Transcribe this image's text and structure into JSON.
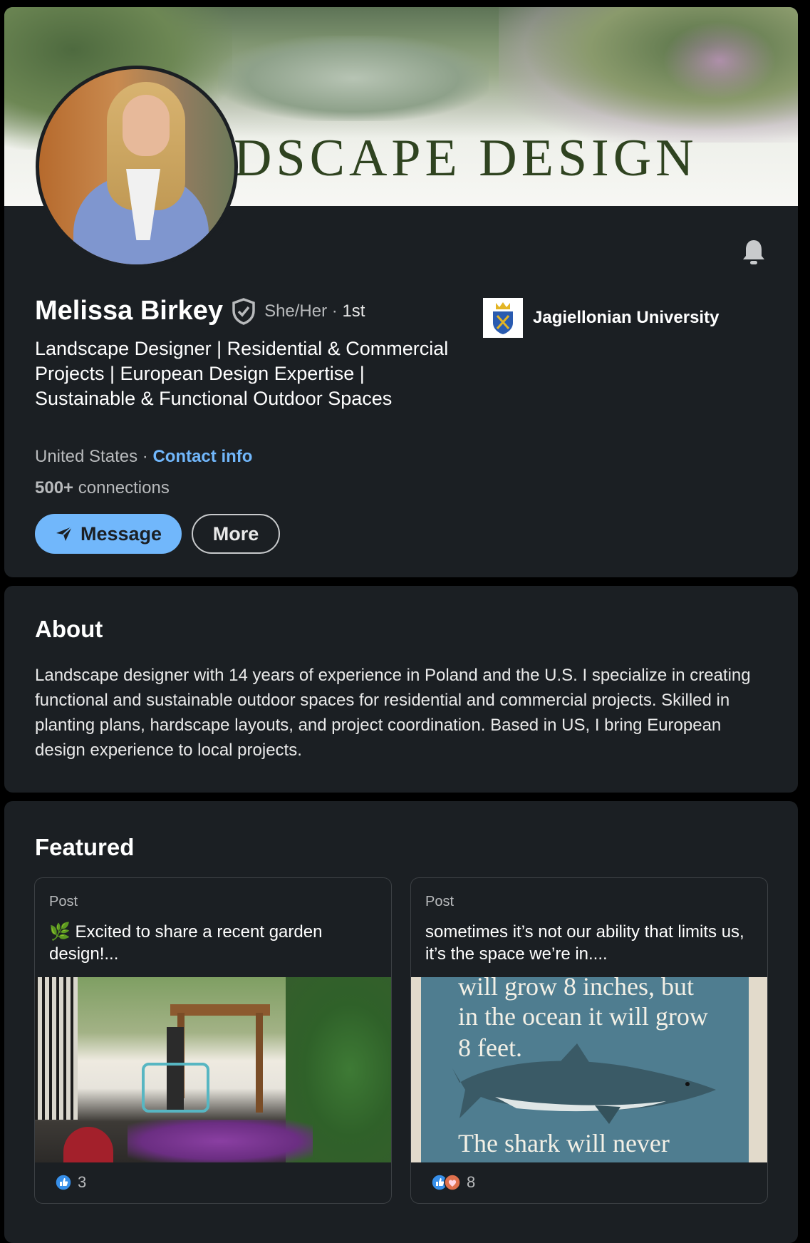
{
  "banner": {
    "text": "DSCAPE DESIGN"
  },
  "profile": {
    "name": "Melissa Birkey",
    "pronouns": "She/Her",
    "separator": "·",
    "degree": "1st",
    "headline": "Landscape Designer | Residential & Commercial Projects | European Design Expertise | Sustainable & Functional Outdoor Spaces",
    "location": "United States",
    "contact_link": "Contact info",
    "connections_count": "500+",
    "connections_label": "connections",
    "message_button": "Message",
    "more_button": "More",
    "education": "Jagiellonian University"
  },
  "about": {
    "title": "About",
    "text": "Landscape designer with 14 years of experience in Poland and the U.S. I specialize in creating functional and sustainable outdoor spaces for residential and commercial projects. Skilled in planting plans, hardscape layouts, and project coordination. Based in US, I bring European design experience to local projects."
  },
  "featured": {
    "title": "Featured",
    "posts": [
      {
        "type": "Post",
        "text": "🌿 Excited to share a recent garden design!...",
        "reactions": "3",
        "reaction_icons": [
          "like-icon"
        ]
      },
      {
        "type": "Post",
        "text": "sometimes it’s not our ability that limits us, it’s the space we’re in....",
        "reactions": "8",
        "reaction_icons": [
          "like-icon",
          "love-icon"
        ],
        "image_lines": [
          "will grow 8 inches, but",
          "in the ocean it will grow",
          "8 feet.",
          "The shark will never"
        ]
      }
    ]
  },
  "colors": {
    "background": "#000000",
    "card": "#1b1f23",
    "accent": "#71b7fb",
    "muted_text": "#b8babc"
  }
}
